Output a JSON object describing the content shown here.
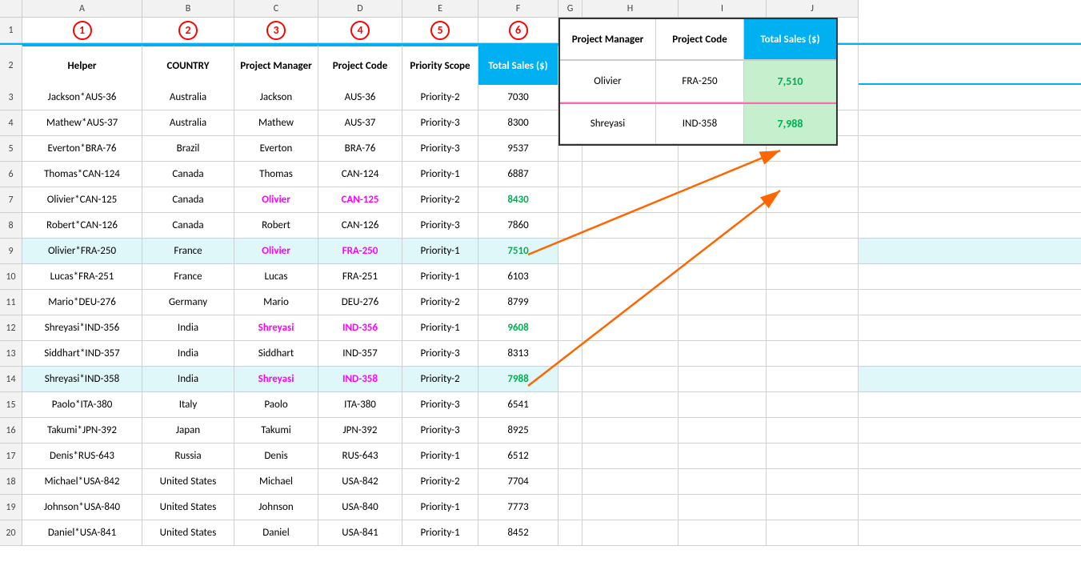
{
  "columns": {
    "headers": [
      "",
      "A",
      "B",
      "C",
      "D",
      "E",
      "F",
      "G",
      "H",
      "I",
      "J"
    ],
    "row_numbers": [
      1,
      2,
      3,
      4,
      5,
      6,
      7,
      8,
      9,
      10,
      11,
      12,
      13,
      14,
      15,
      16,
      17,
      18,
      19,
      20
    ]
  },
  "row1": {
    "a_label": "1",
    "b_label": "2",
    "c_label": "3",
    "d_label": "4",
    "e_label": "5",
    "f_label": "6"
  },
  "header_row": {
    "a": "Helper",
    "b": "COUNTRY",
    "c": "Project Manager",
    "d": "Project Code",
    "e": "Priority Scope",
    "f": "Total Sales ($)",
    "h": "Project Manager",
    "i": "Project Code",
    "j": "Total Sales ($)"
  },
  "rows": [
    {
      "num": 3,
      "a": "Jackson*AUS-36",
      "b": "Australia",
      "c": "Jackson",
      "d": "AUS-36",
      "e": "Priority-2",
      "f": "7030",
      "highlight": false
    },
    {
      "num": 4,
      "a": "Mathew*AUS-37",
      "b": "Australia",
      "c": "Mathew",
      "d": "AUS-37",
      "e": "Priority-3",
      "f": "8300",
      "highlight": false
    },
    {
      "num": 5,
      "a": "Everton*BRA-76",
      "b": "Brazil",
      "c": "Everton",
      "d": "BRA-76",
      "e": "Priority-3",
      "f": "9537",
      "highlight": false
    },
    {
      "num": 6,
      "a": "Thomas*CAN-124",
      "b": "Canada",
      "c": "Thomas",
      "d": "CAN-124",
      "e": "Priority-1",
      "f": "6887",
      "highlight": false
    },
    {
      "num": 7,
      "a": "Olivier*CAN-125",
      "b": "Canada",
      "c": "Olivier",
      "d": "CAN-125",
      "e": "Priority-2",
      "f": "8430",
      "highlight": true,
      "c_magenta": true,
      "d_magenta": true,
      "f_green": true
    },
    {
      "num": 8,
      "a": "Robert*CAN-126",
      "b": "Canada",
      "c": "Robert",
      "d": "CAN-126",
      "e": "Priority-3",
      "f": "7860",
      "highlight": false
    },
    {
      "num": 9,
      "a": "Olivier*FRA-250",
      "b": "France",
      "c": "Olivier",
      "d": "FRA-250",
      "e": "Priority-1",
      "f": "7510",
      "highlight": false,
      "c_magenta": true,
      "d_magenta": true,
      "f_green": true
    },
    {
      "num": 10,
      "a": "Lucas*FRA-251",
      "b": "France",
      "c": "Lucas",
      "d": "FRA-251",
      "e": "Priority-1",
      "f": "6103",
      "highlight": false
    },
    {
      "num": 11,
      "a": "Mario*DEU-276",
      "b": "Germany",
      "c": "Mario",
      "d": "DEU-276",
      "e": "Priority-2",
      "f": "8799",
      "highlight": false
    },
    {
      "num": 12,
      "a": "Shreyasi*IND-356",
      "b": "India",
      "c": "Shreyasi",
      "d": "IND-356",
      "e": "Priority-1",
      "f": "9608",
      "highlight": false,
      "c_magenta": true,
      "d_magenta": true,
      "f_green": true
    },
    {
      "num": 13,
      "a": "Siddhart*IND-357",
      "b": "India",
      "c": "Siddhart",
      "d": "IND-357",
      "e": "Priority-3",
      "f": "8313",
      "highlight": false
    },
    {
      "num": 14,
      "a": "Shreyasi*IND-358",
      "b": "India",
      "c": "Shreyasi",
      "d": "IND-358",
      "e": "Priority-2",
      "f": "7988",
      "highlight": false,
      "c_magenta": true,
      "d_magenta": true,
      "f_green": true
    },
    {
      "num": 15,
      "a": "Paolo*ITA-380",
      "b": "Italy",
      "c": "Paolo",
      "d": "ITA-380",
      "e": "Priority-3",
      "f": "6541",
      "highlight": false
    },
    {
      "num": 16,
      "a": "Takumi*JPN-392",
      "b": "Japan",
      "c": "Takumi",
      "d": "JPN-392",
      "e": "Priority-3",
      "f": "8925",
      "highlight": false
    },
    {
      "num": 17,
      "a": "Denis*RUS-643",
      "b": "Russia",
      "c": "Denis",
      "d": "RUS-643",
      "e": "Priority-1",
      "f": "6512",
      "highlight": false
    },
    {
      "num": 18,
      "a": "Michael*USA-842",
      "b": "United States",
      "c": "Michael",
      "d": "USA-842",
      "e": "Priority-2",
      "f": "7704",
      "highlight": false
    },
    {
      "num": 19,
      "a": "Johnson*USA-840",
      "b": "United States",
      "c": "Johnson",
      "d": "USA-840",
      "e": "Priority-1",
      "f": "7773",
      "highlight": false
    },
    {
      "num": 20,
      "a": "Daniel*USA-841",
      "b": "United States",
      "c": "Daniel",
      "d": "USA-841",
      "e": "Priority-1",
      "f": "8452",
      "highlight": false
    }
  ],
  "right_table": {
    "row3": {
      "h": "Olivier",
      "i": "FRA-250",
      "j": "7,510"
    },
    "row4": {
      "h": "Shreyasi",
      "i": "IND-358",
      "j": "7,988"
    }
  },
  "colors": {
    "accent_blue": "#00b0f0",
    "green": "#00b050",
    "magenta": "#ff00ff",
    "orange_arrow": "#ff6600",
    "teal_bg": "#c6efce",
    "light_yellow": "#ffff99",
    "pink_border": "#ff69b4",
    "red_circle": "#ff0000"
  }
}
